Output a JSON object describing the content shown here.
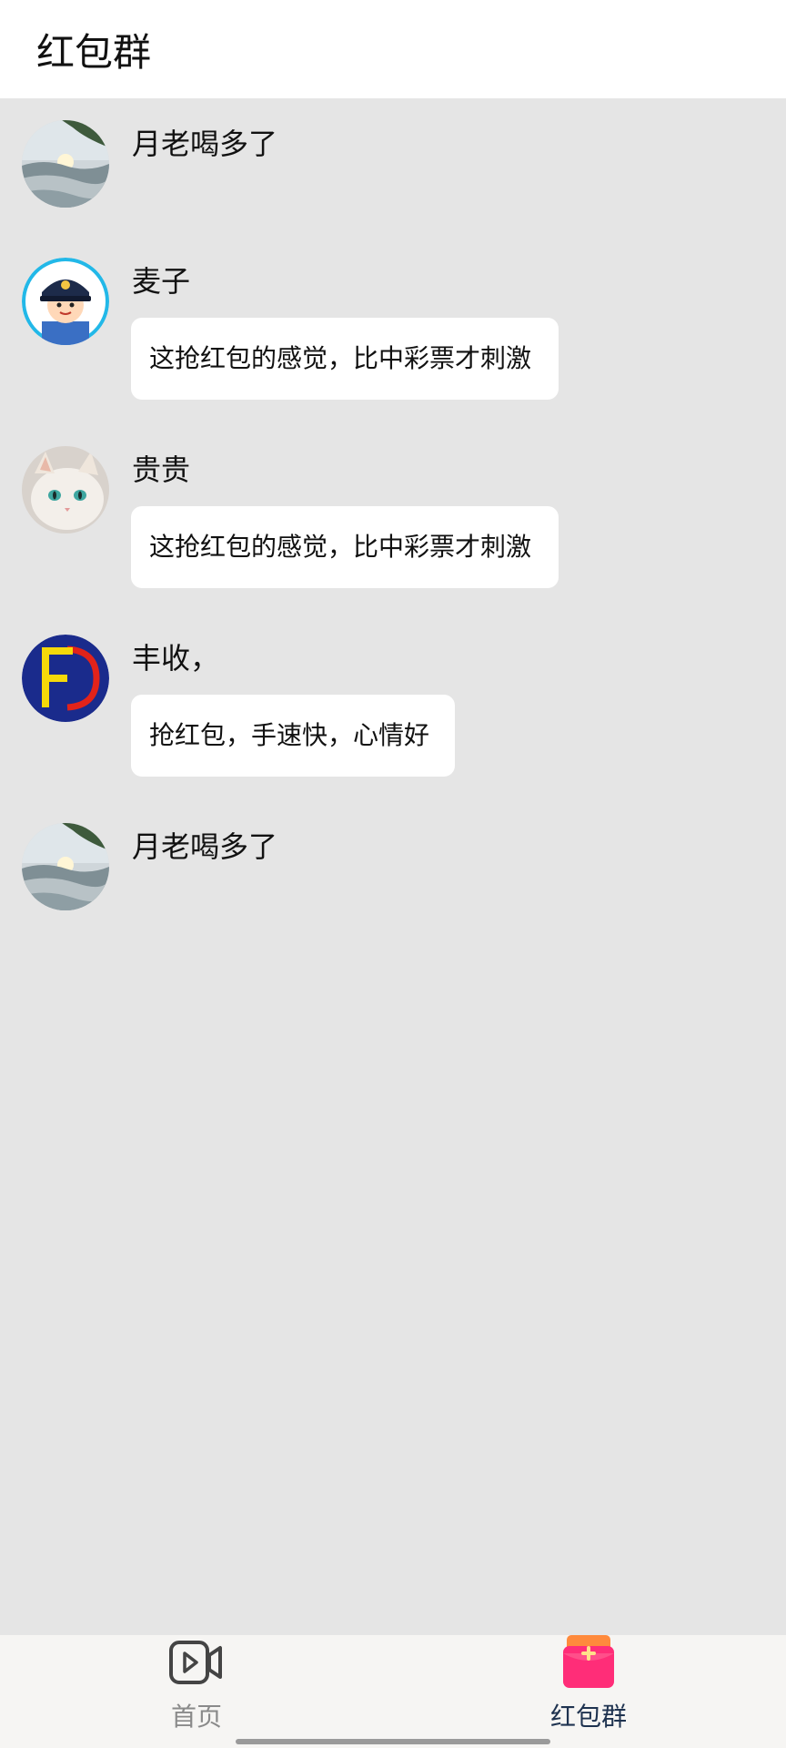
{
  "header": {
    "title": "红包群"
  },
  "messages": [
    {
      "sender": "月老喝多了",
      "avatar": "landscape-avatar",
      "text": null
    },
    {
      "sender": "麦子",
      "avatar": "police-cartoon-avatar",
      "text": "这抢红包的感觉，比中彩票才刺激"
    },
    {
      "sender": "贵贵",
      "avatar": "white-cat-avatar",
      "text": "这抢红包的感觉，比中彩票才刺激"
    },
    {
      "sender": "丰收，",
      "avatar": "fd-logo-avatar",
      "text": "抢红包，手速快，心情好"
    },
    {
      "sender": "月老喝多了",
      "avatar": "landscape-avatar",
      "text": null
    }
  ],
  "tabbar": {
    "tabs": [
      {
        "label": "首页",
        "icon": "video-camera-icon",
        "active": false
      },
      {
        "label": "红包群",
        "icon": "red-envelope-icon",
        "active": true
      }
    ],
    "active_color": "#1f3350",
    "inactive_color": "#8a8a8a"
  },
  "colors": {
    "background": "#e5e5e5",
    "header_bg": "#ffffff",
    "bubble_bg": "#ffffff",
    "accent_pink": "#ff2d78"
  }
}
